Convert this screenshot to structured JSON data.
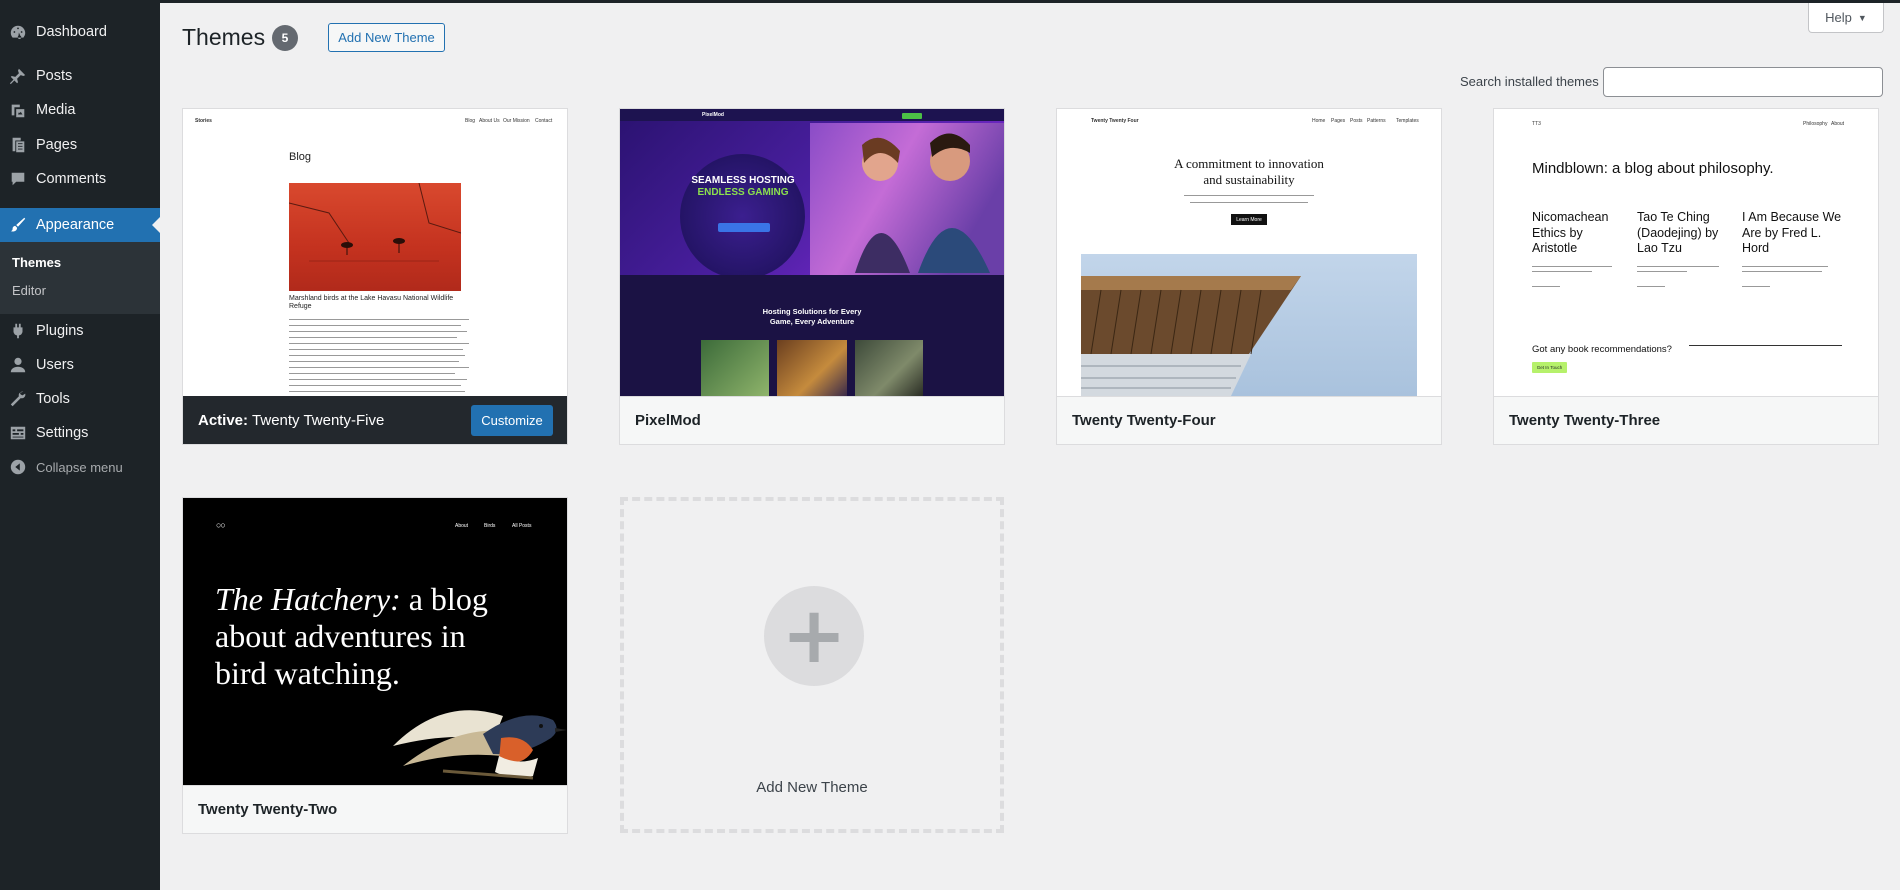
{
  "sidebar": {
    "items": [
      {
        "label": "Dashboard",
        "icon": "dashboard-icon"
      },
      {
        "label": "Posts",
        "icon": "pin-icon"
      },
      {
        "label": "Media",
        "icon": "media-icon"
      },
      {
        "label": "Pages",
        "icon": "pages-icon"
      },
      {
        "label": "Comments",
        "icon": "comments-icon"
      },
      {
        "label": "Appearance",
        "icon": "brush-icon"
      },
      {
        "label": "Plugins",
        "icon": "plugin-icon"
      },
      {
        "label": "Users",
        "icon": "users-icon"
      },
      {
        "label": "Tools",
        "icon": "wrench-icon"
      },
      {
        "label": "Settings",
        "icon": "settings-icon"
      }
    ],
    "submenu": [
      "Themes",
      "Editor"
    ],
    "collapse_label": "Collapse menu"
  },
  "header": {
    "title": "Themes",
    "count": "5",
    "add_new_label": "Add New Theme",
    "help_label": "Help"
  },
  "search": {
    "label": "Search installed themes",
    "value": "",
    "placeholder": ""
  },
  "themes": [
    {
      "name": "Twenty Twenty-Five",
      "active_label": "Active:",
      "customize_label": "Customize",
      "preview": {
        "site": "Stories",
        "nav": [
          "Blog",
          "About Us",
          "Our Mission",
          "Contact"
        ],
        "heading": "Blog",
        "caption": "Marshland birds at the Lake Havasu National Wildlife Refuge"
      }
    },
    {
      "name": "PixelMod",
      "preview": {
        "logo": "PixelMod",
        "hero1": "SEAMLESS HOSTING",
        "hero2": "ENDLESS GAMING",
        "sub1": "Hosting Solutions for Every",
        "sub2": "Game, Every Adventure"
      }
    },
    {
      "name": "Twenty Twenty-Four",
      "preview": {
        "site": "Twenty Twenty Four",
        "nav": [
          "Home",
          "Pages",
          "Posts",
          "Patterns",
          "Templates"
        ],
        "heading1": "A commitment to innovation",
        "heading2": "and sustainability",
        "button": "Learn More"
      }
    },
    {
      "name": "Twenty Twenty-Three",
      "preview": {
        "site": "TT3",
        "nav": [
          "Philosophy",
          "About"
        ],
        "heading": "Mindblown: a blog about philosophy.",
        "posts": [
          [
            "Nicomachean",
            "Ethics by",
            "Aristotle"
          ],
          [
            "Tao Te Ching",
            "(Daodejing) by",
            "Lao Tzu"
          ],
          [
            "I Am Because We",
            "Are by Fred L.",
            "Hord"
          ]
        ],
        "question": "Got any book recommendations?",
        "button": "Get In Touch"
      }
    },
    {
      "name": "Twenty Twenty-Two",
      "preview": {
        "nav": [
          "About",
          "Birds",
          "All Posts"
        ],
        "line1_italic": "The Hatchery:",
        "line1_rest": " a blog",
        "line2": "about adventures in",
        "line3": "bird watching."
      }
    }
  ],
  "add_card_label": "Add New Theme",
  "colors": {
    "admin_bar": "#1d2327",
    "accent": "#2271b1",
    "background": "#f0f0f1"
  }
}
